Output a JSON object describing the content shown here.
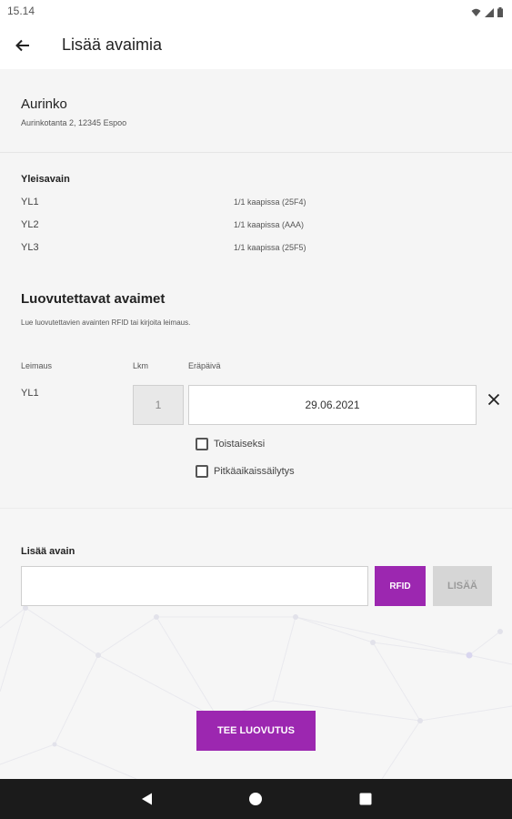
{
  "status_bar": {
    "time": "15.14",
    "icons": [
      "wifi-icon",
      "signal-icon",
      "battery-icon"
    ]
  },
  "app_bar": {
    "title": "Lisää avaimia",
    "back_icon": "arrow-left-icon"
  },
  "site": {
    "name": "Aurinko",
    "address": "Aurinkotanta 2, 12345 Espoo"
  },
  "master_keys": {
    "title": "Yleisavain",
    "rows": [
      {
        "name": "YL1",
        "status": "1/1 kaapissa (25F4)"
      },
      {
        "name": "YL2",
        "status": "1/1 kaapissa (AAA)"
      },
      {
        "name": "YL3",
        "status": "1/1 kaapissa (25F5)"
      }
    ]
  },
  "handover": {
    "title": "Luovutettavat avaimet",
    "description": "Lue luovutettavien avainten RFID tai kirjoita leimaus.",
    "columns": {
      "stamp": "Leimaus",
      "qty": "Lkm",
      "due": "Eräpäivä"
    },
    "row": {
      "stamp": "YL1",
      "qty": "1",
      "due_date": "29.06.2021"
    },
    "checkboxes": [
      {
        "label": "Toistaiseksi",
        "checked": false
      },
      {
        "label": "Pitkäaikaissäilytys",
        "checked": false
      }
    ]
  },
  "add_key": {
    "title": "Lisää avain",
    "input_value": "",
    "rfid_label": "RFID",
    "add_label": "LISÄÄ"
  },
  "submit_label": "TEE LUOVUTUS",
  "colors": {
    "accent": "#9c27b0",
    "disabled": "#d6d6d6",
    "navbar": "#1b1b1b"
  }
}
